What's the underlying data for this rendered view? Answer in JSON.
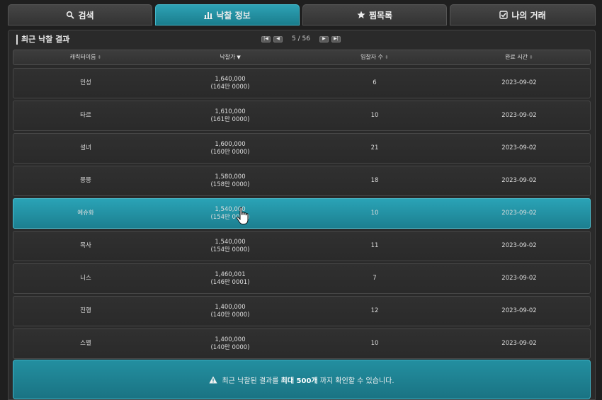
{
  "tabs": [
    {
      "label": "검색",
      "icon": "search-icon",
      "active": false
    },
    {
      "label": "낙찰 정보",
      "icon": "chart-icon",
      "active": true
    },
    {
      "label": "찜목록",
      "icon": "star-icon",
      "active": false
    },
    {
      "label": "나의 거래",
      "icon": "checkbox-icon",
      "active": false
    }
  ],
  "panel": {
    "title": "최근 낙찰 결과",
    "pager": {
      "current": "5",
      "separator": "/",
      "total": "56",
      "display": "5 / 56"
    }
  },
  "table": {
    "columns": [
      "캐릭터이름",
      "낙찰가",
      "입찰자 수",
      "완료 시간"
    ],
    "sorted_column": "낙찰가",
    "rows": [
      {
        "name": "민성",
        "price": "1,640,000",
        "price_kr": "(164만 0000)",
        "bidders": "6",
        "time": "2023-09-02"
      },
      {
        "name": "타르",
        "price": "1,610,000",
        "price_kr": "(161만 0000)",
        "bidders": "10",
        "time": "2023-09-02"
      },
      {
        "name": "설녀",
        "price": "1,600,000",
        "price_kr": "(160만 0000)",
        "bidders": "21",
        "time": "2023-09-02"
      },
      {
        "name": "뭉뭉",
        "price": "1,580,000",
        "price_kr": "(158만 0000)",
        "bidders": "18",
        "time": "2023-09-02"
      },
      {
        "name": "예슈화",
        "price": "1,540,000",
        "price_kr": "(154만 0000)",
        "bidders": "10",
        "time": "2023-09-02",
        "selected": true
      },
      {
        "name": "목사",
        "price": "1,540,000",
        "price_kr": "(154만 0000)",
        "bidders": "11",
        "time": "2023-09-02"
      },
      {
        "name": "니스",
        "price": "1,460,001",
        "price_kr": "(146만 0001)",
        "bidders": "7",
        "time": "2023-09-02"
      },
      {
        "name": "진행",
        "price": "1,400,000",
        "price_kr": "(140만 0000)",
        "bidders": "12",
        "time": "2023-09-02"
      },
      {
        "name": "스펠",
        "price": "1,400,000",
        "price_kr": "(140만 0000)",
        "bidders": "10",
        "time": "2023-09-02"
      }
    ]
  },
  "notice": {
    "prefix": "최근 낙찰된 결과를",
    "highlight": "최대 500개",
    "suffix": "까지 확인할 수 있습니다.",
    "icon": "warning-icon"
  },
  "colors": {
    "accent": "#1f8fa1",
    "background": "#1f1f1f",
    "row": "#2d2d2d"
  }
}
